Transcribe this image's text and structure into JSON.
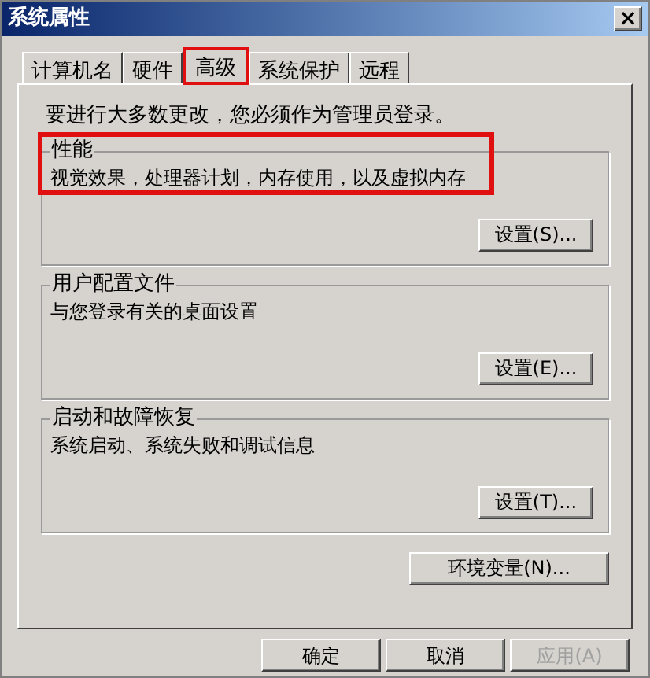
{
  "window": {
    "title": "系统属性",
    "close": "×"
  },
  "tabs": [
    {
      "label": "计算机名",
      "selected": false,
      "highlighted": false
    },
    {
      "label": "硬件",
      "selected": false,
      "highlighted": false
    },
    {
      "label": "高级",
      "selected": true,
      "highlighted": true
    },
    {
      "label": "系统保护",
      "selected": false,
      "highlighted": false
    },
    {
      "label": "远程",
      "selected": false,
      "highlighted": false
    }
  ],
  "notice": "要进行大多数更改，您必须作为管理员登录。",
  "groups": [
    {
      "title": "性能",
      "description": "视觉效果，处理器计划，内存使用，以及虚拟内存",
      "button": "设置(S)...",
      "highlighted": true
    },
    {
      "title": "用户配置文件",
      "description": "与您登录有关的桌面设置",
      "button": "设置(E)...",
      "highlighted": false
    },
    {
      "title": "启动和故障恢复",
      "description": "系统启动、系统失败和调试信息",
      "button": "设置(T)...",
      "highlighted": false
    }
  ],
  "env_button": "环境变量(N)...",
  "buttons": [
    {
      "label": "确定",
      "disabled": false
    },
    {
      "label": "取消",
      "disabled": false
    },
    {
      "label": "应用(A)",
      "disabled": true
    }
  ]
}
